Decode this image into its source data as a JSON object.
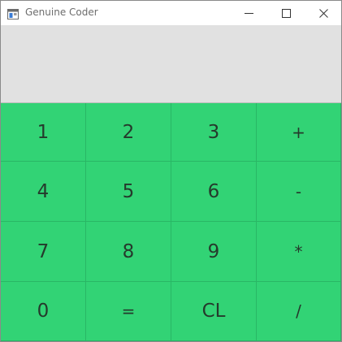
{
  "window": {
    "title": "Genuine Coder"
  },
  "display": {
    "value": ""
  },
  "keys": [
    {
      "label": "1",
      "name": "key-1-button",
      "kind": "digit"
    },
    {
      "label": "2",
      "name": "key-2-button",
      "kind": "digit"
    },
    {
      "label": "3",
      "name": "key-3-button",
      "kind": "digit"
    },
    {
      "label": "+",
      "name": "key-plus-button",
      "kind": "op"
    },
    {
      "label": "4",
      "name": "key-4-button",
      "kind": "digit"
    },
    {
      "label": "5",
      "name": "key-5-button",
      "kind": "digit"
    },
    {
      "label": "6",
      "name": "key-6-button",
      "kind": "digit"
    },
    {
      "label": "-",
      "name": "key-minus-button",
      "kind": "op"
    },
    {
      "label": "7",
      "name": "key-7-button",
      "kind": "digit"
    },
    {
      "label": "8",
      "name": "key-8-button",
      "kind": "digit"
    },
    {
      "label": "9",
      "name": "key-9-button",
      "kind": "digit"
    },
    {
      "label": "*",
      "name": "key-multiply-button",
      "kind": "op"
    },
    {
      "label": "0",
      "name": "key-0-button",
      "kind": "digit"
    },
    {
      "label": "=",
      "name": "key-equals-button",
      "kind": "op"
    },
    {
      "label": "CL",
      "name": "key-clear-button",
      "kind": "digit"
    },
    {
      "label": "/",
      "name": "key-divide-button",
      "kind": "op"
    }
  ],
  "colors": {
    "keypad_background": "#32d375",
    "display_background": "#e1e1e1",
    "key_text": "#253a2c"
  },
  "icons": {
    "app": "app-window-icon",
    "minimize": "minimize-icon",
    "maximize": "maximize-icon",
    "close": "close-icon"
  }
}
